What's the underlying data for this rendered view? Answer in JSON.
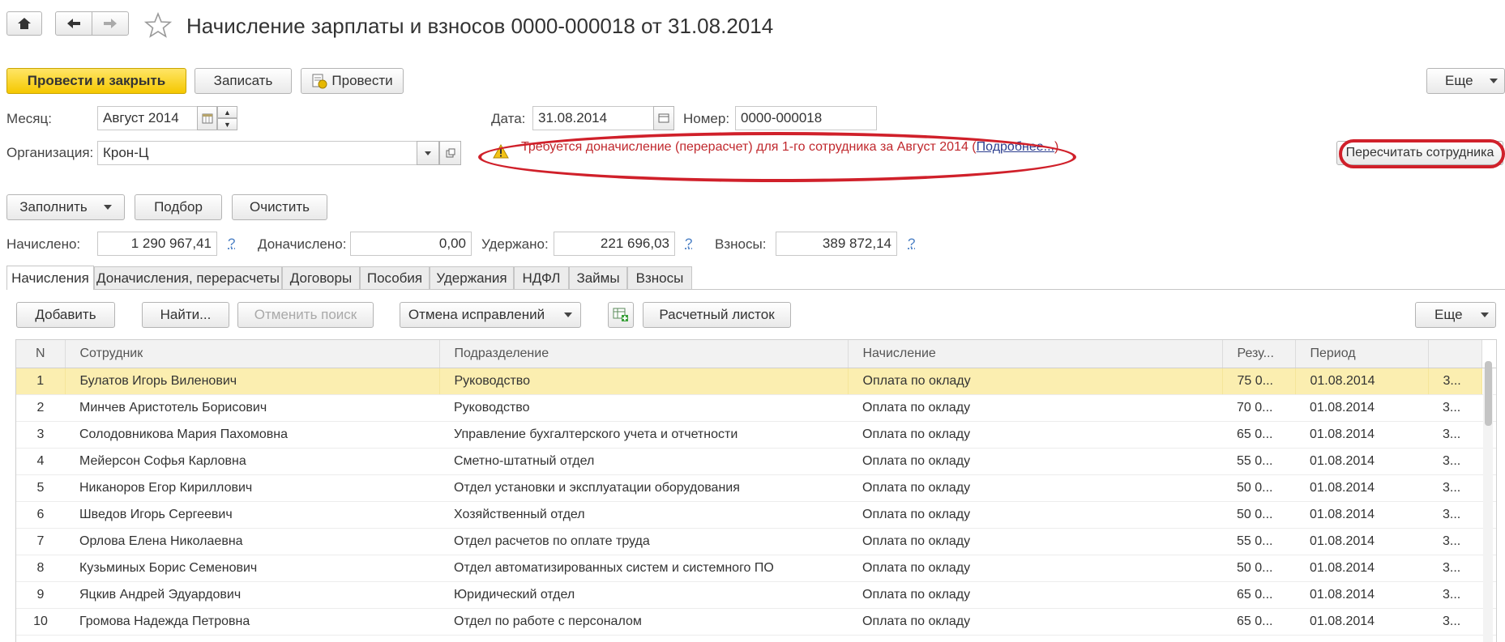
{
  "nav": {
    "home_icon": "home-icon",
    "back_icon": "arrow-left-icon",
    "forward_icon": "arrow-right-icon",
    "star_icon": "star-icon"
  },
  "title": "Начисление зарплаты и взносов 0000-000018 от 31.08.2014",
  "toolbar": {
    "post_close": "Провести и закрыть",
    "save": "Записать",
    "post": "Провести",
    "more": "Еще"
  },
  "header": {
    "month_label": "Месяц:",
    "month_value": "Август 2014",
    "date_label": "Дата:",
    "date_value": "31.08.2014",
    "number_label": "Номер:",
    "number_value": "0000-000018",
    "org_label": "Организация:",
    "org_value": "Крон-Ц"
  },
  "warning": {
    "text": "Требуется доначисление (перерасчет) для 1-го сотрудника за Август 2014 (",
    "link": "Подробнее...",
    "tail": ").",
    "recalc_button": "Пересчитать сотрудника"
  },
  "actions": {
    "fill": "Заполнить",
    "select": "Подбор",
    "clear": "Очистить"
  },
  "totals": {
    "accrued_label": "Начислено:",
    "accrued_value": "1 290 967,41",
    "additional_label": "Доначислено:",
    "additional_value": "0,00",
    "withheld_label": "Удержано:",
    "withheld_value": "221 696,03",
    "contrib_label": "Взносы:",
    "contrib_value": "389 872,14",
    "help": "?"
  },
  "tabs": [
    "Начисления",
    "Доначисления, перерасчеты",
    "Договоры",
    "Пособия",
    "Удержания",
    "НДФЛ",
    "Займы",
    "Взносы"
  ],
  "table_toolbar": {
    "add": "Добавить",
    "find": "Найти...",
    "cancel_search": "Отменить поиск",
    "cancel_corrections": "Отмена исправлений",
    "payslip": "Расчетный листок",
    "more": "Еще"
  },
  "columns": [
    "N",
    "Сотрудник",
    "Подразделение",
    "Начисление",
    "Резу...",
    "Период",
    ""
  ],
  "rows": [
    [
      "1",
      "Булатов Игорь Виленович",
      "Руководство",
      "Оплата по окладу",
      "75 0...",
      "01.08.2014",
      "3..."
    ],
    [
      "2",
      "Минчев Аристотель Борисович",
      "Руководство",
      "Оплата по окладу",
      "70 0...",
      "01.08.2014",
      "3..."
    ],
    [
      "3",
      "Солодовникова Мария Пахомовна",
      "Управление бухгалтерского учета и отчетности",
      "Оплата по окладу",
      "65 0...",
      "01.08.2014",
      "3..."
    ],
    [
      "4",
      "Мейерсон Софья Карловна",
      "Сметно-штатный отдел",
      "Оплата по окладу",
      "55 0...",
      "01.08.2014",
      "3..."
    ],
    [
      "5",
      "Никаноров Егор Кириллович",
      "Отдел установки и эксплуатации оборудования",
      "Оплата по окладу",
      "50 0...",
      "01.08.2014",
      "3..."
    ],
    [
      "6",
      "Шведов Игорь Сергеевич",
      "Хозяйственный отдел",
      "Оплата по окладу",
      "50 0...",
      "01.08.2014",
      "3..."
    ],
    [
      "7",
      "Орлова Елена Николаевна",
      "Отдел расчетов по оплате труда",
      "Оплата по окладу",
      "55 0...",
      "01.08.2014",
      "3..."
    ],
    [
      "8",
      "Кузьминых Борис Семенович",
      "Отдел автоматизированных систем и системного ПО",
      "Оплата по окладу",
      "50 0...",
      "01.08.2014",
      "3..."
    ],
    [
      "9",
      "Яцкив Андрей Эдуардович",
      "Юридический отдел",
      "Оплата по окладу",
      "65 0...",
      "01.08.2014",
      "3..."
    ],
    [
      "10",
      "Громова Надежда Петровна",
      "Отдел по работе с персоналом",
      "Оплата по окладу",
      "65 0...",
      "01.08.2014",
      "3..."
    ]
  ],
  "colors": {
    "accent": "#f5c800",
    "warning_text": "#c0282d",
    "highlight_ellipse": "#d0202a",
    "selected_row": "#fbeeb0"
  }
}
